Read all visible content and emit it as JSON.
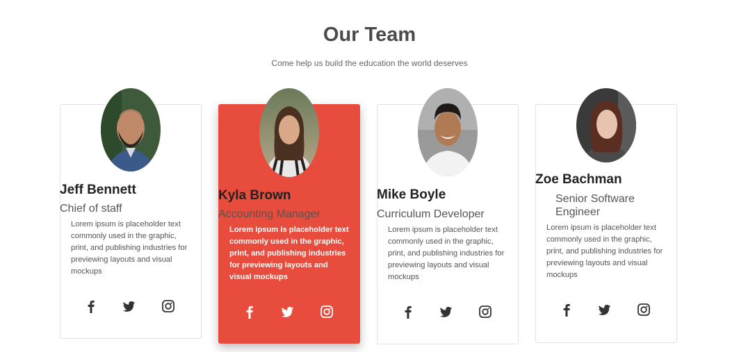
{
  "header": {
    "title": "Our Team",
    "subtitle": "Come help us build the education the world deserves"
  },
  "colors": {
    "accent": "#e74c3c",
    "icon": "#333333",
    "card_border": "#e2e2e2"
  },
  "members": [
    {
      "name": "Jeff Bennett",
      "role": "Chief of staff",
      "description": "Lorem ipsum is placeholder text commonly used in the graphic, print, and publishing industries for previewing layouts and visual mockups",
      "social": [
        "facebook-icon",
        "twitter-icon",
        "instagram-icon"
      ]
    },
    {
      "name": "Kyla Brown",
      "role": "Accounting Manager",
      "description": "Lorem ipsum is placeholder text commonly used in the graphic, print, and publishing industries for previewing layouts and visual mockups",
      "social": [
        "facebook-icon",
        "twitter-icon",
        "instagram-icon"
      ],
      "highlighted": true
    },
    {
      "name": "Mike Boyle",
      "role": "Curriculum Developer",
      "description": "Lorem ipsum is placeholder text commonly used in the graphic, print, and publishing industries for previewing layouts and visual mockups",
      "social": [
        "facebook-icon",
        "twitter-icon",
        "instagram-icon"
      ]
    },
    {
      "name": "Zoe Bachman",
      "role": "Senior Software Engineer",
      "description": "Lorem ipsum is placeholder text commonly used in the graphic, print, and publishing industries for previewing layouts and visual mockups",
      "social": [
        "facebook-icon",
        "twitter-icon",
        "instagram-icon"
      ]
    }
  ]
}
